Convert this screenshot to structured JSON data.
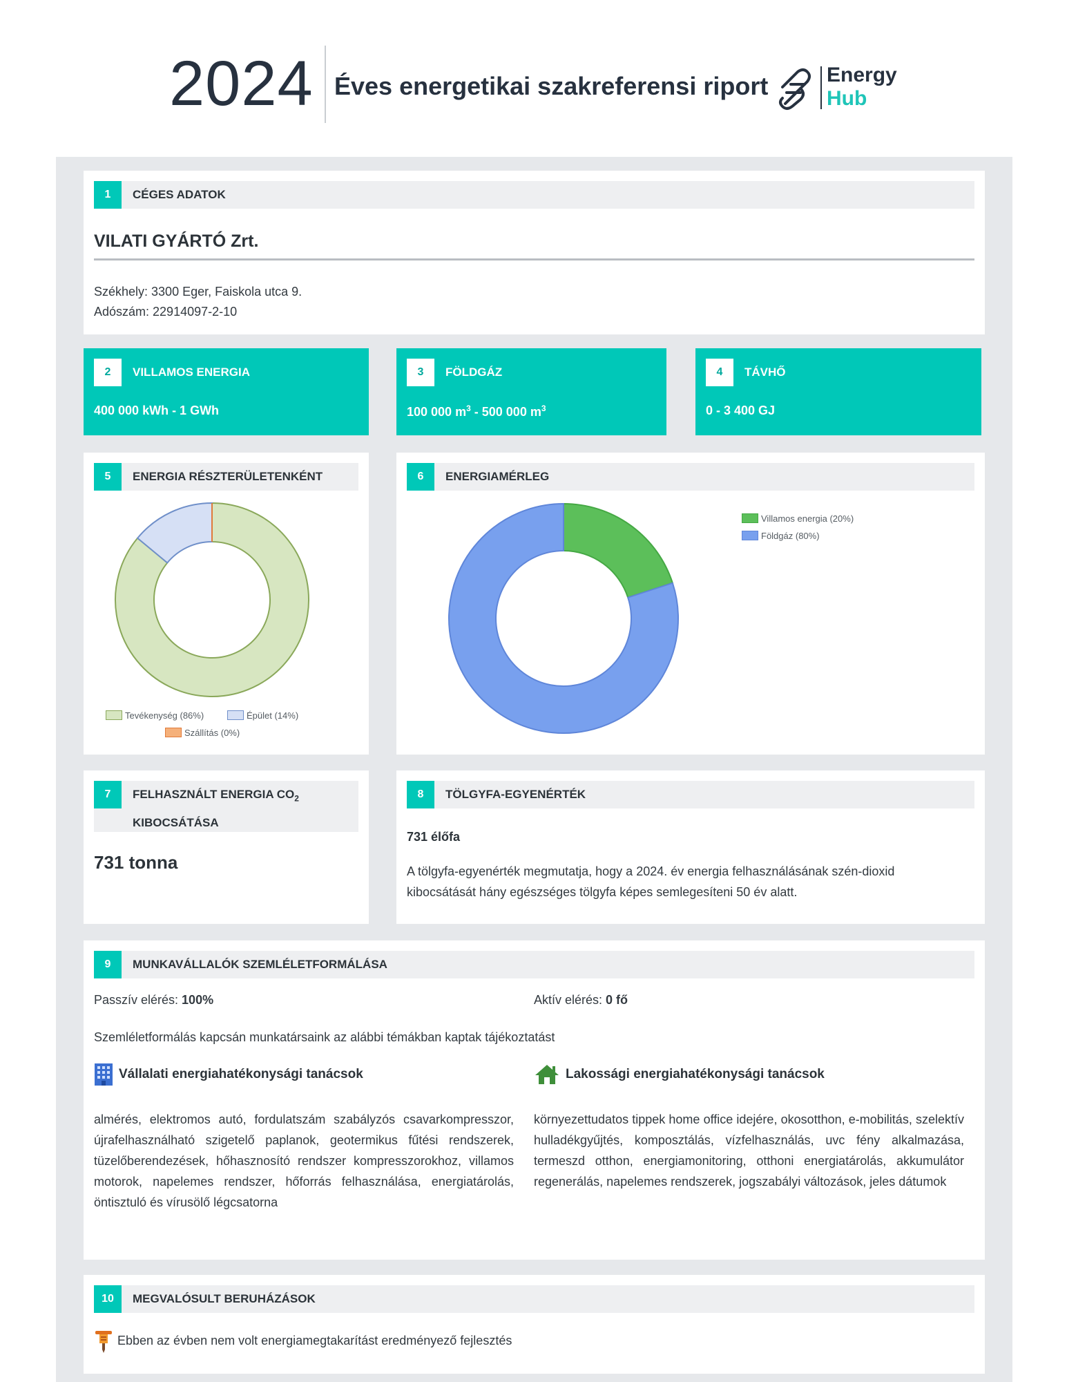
{
  "header": {
    "year": "2024",
    "title": "Éves energetikai szakreferensi riport",
    "logo_line1": "Energy",
    "logo_line2": "Hub"
  },
  "colors": {
    "accent": "#00c8b8",
    "dark": "#27313f",
    "background": "#e6e8eb"
  },
  "s1": {
    "num": "1",
    "title": "CÉGES ADATOK",
    "company": "VILATI GYÁRTÓ Zrt.",
    "address": "Székhely: 3300 Eger, Faiskola utca 9.",
    "tax": "Adószám: 22914097-2-10"
  },
  "s2": {
    "num": "2",
    "title": "VILLAMOS ENERGIA",
    "value": "400 000 kWh - 1 GWh"
  },
  "s3": {
    "num": "3",
    "title": "FÖLDGÁZ",
    "v1": "100 000 m",
    "v2": " - 500 000 m",
    "sup": "3"
  },
  "s4": {
    "num": "4",
    "title": "TÁVHŐ",
    "value": "0 - 3 400 GJ"
  },
  "s5": {
    "num": "5",
    "title": "ENERGIA RÉSZTERÜLETENKÉNT"
  },
  "s6": {
    "num": "6",
    "title": "ENERGIAMÉRLEG"
  },
  "chart_data": [
    {
      "type": "pie",
      "categories": [
        "Tevékenység",
        "Épület",
        "Szállítás"
      ],
      "values": [
        86,
        14,
        0
      ],
      "legend": [
        "Tevékenység (86%)",
        "Épület (14%)",
        "Szállítás (0%)"
      ],
      "colors": [
        "#d7e6c1",
        "#d6e0f5",
        "#f5b07a"
      ],
      "stroke": [
        "#8aa85a",
        "#6f8fc9",
        "#e07a3a"
      ],
      "legend_position": "bottom"
    },
    {
      "type": "pie",
      "categories": [
        "Villamos energia",
        "Földgáz"
      ],
      "values": [
        20,
        80
      ],
      "legend": [
        "Villamos energia (20%)",
        "Földgáz (80%)"
      ],
      "colors": [
        "#5cbf5a",
        "#78a0ee"
      ],
      "stroke": [
        "#45a844",
        "#5f86d9"
      ],
      "legend_position": "top-right"
    }
  ],
  "s7": {
    "num": "7",
    "title_a": "FELHASZNÁLT ENERGIA CO",
    "title_sub": "2",
    "title_b": "KIBOCSÁTÁSA",
    "value": "731 tonna"
  },
  "s8": {
    "num": "8",
    "title": "TÖLGYFA-EGYENÉRTÉK",
    "value": "731 élőfa",
    "desc": "A tölgyfa-egyenérték megmutatja, hogy a 2024. év energia felhasználásának szén-dioxid kibocsátását hány egészséges tölgyfa képes semlegesíteni 50 év alatt."
  },
  "s9": {
    "num": "9",
    "title": "MUNKAVÁLLALÓK SZEMLÉLETFORMÁLÁSA",
    "passive_label": "Passzív elérés: ",
    "passive_value": "100%",
    "active_label": "Aktív elérés: ",
    "active_value": "0 fő",
    "intro": "Szemléletformálás kapcsán munkatársaink az alábbi témákban kaptak tájékoztatást",
    "corp_title": "Vállalati energiahatékonysági tanácsok",
    "corp_text": "almérés, elektromos autó, fordulatszám szabályzós csavarkompresszor, újrafelhasználható szigetelő paplanok, geotermikus fűtési rendszerek, tüzelőberendezések, hőhasznosító rendszer kompresszorokhoz, villamos motorok, napelemes rendszer, hőforrás felhasználása, energiatárolás, öntisztuló és vírusölő légcsatorna",
    "home_title": "Lakossági energiahatékonysági tanácsok",
    "home_text": "környezettudatos tippek home office idejére, okosotthon, e-mobilitás, szelektív hulladékgyűjtés, komposztálás, vízfelhasználás, uvc fény alkalmazása, termeszd otthon, energiamonitoring, otthoni energiatárolás, akkumulátor regenerálás, napelemes rendszerek, jogszabályi változások, jeles dátumok"
  },
  "s10": {
    "num": "10",
    "title": "MEGVALÓSULT BERUHÁZÁSOK",
    "text": "Ebben az évben nem volt energiamegtakarítást eredményező fejlesztés"
  }
}
